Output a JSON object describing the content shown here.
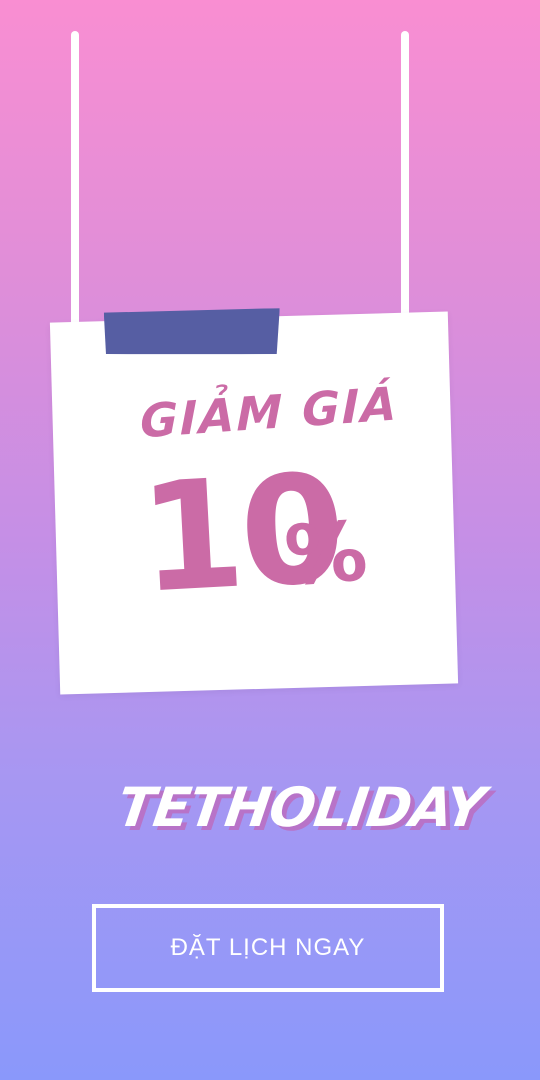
{
  "promo": {
    "headline": "GIẢM GIÁ",
    "discount_value": "10",
    "discount_unit": "%"
  },
  "brand": {
    "name": "TETHOLIDAY"
  },
  "cta": {
    "label": "ĐẶT LỊCH NGAY"
  },
  "colors": {
    "gradient_top": "#f98ed2",
    "gradient_bottom": "#8a98fb",
    "accent_pink": "#cb6ba6",
    "tape": "#565ea3",
    "card": "#ffffff"
  }
}
